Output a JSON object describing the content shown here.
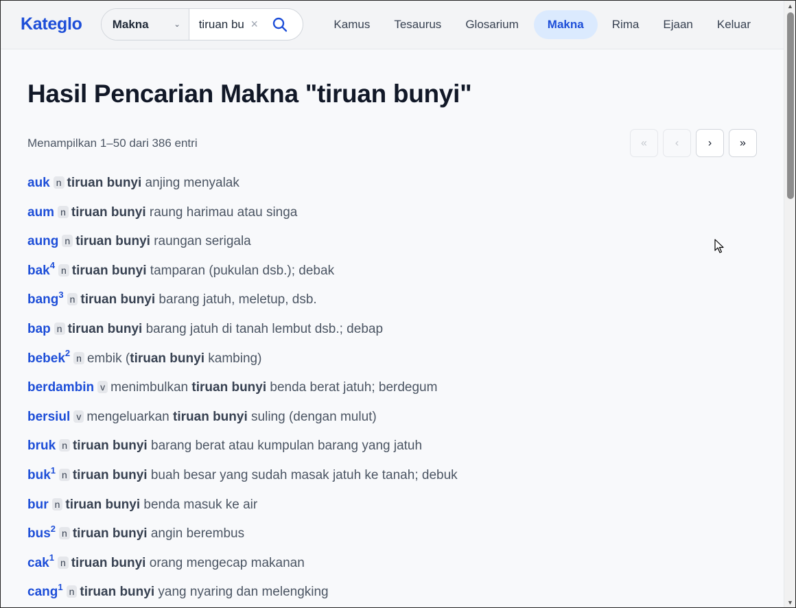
{
  "brand": "Kateglo",
  "search": {
    "mode": "Makna",
    "value": "tiruan bunyi",
    "clear_icon": "×"
  },
  "nav": [
    {
      "label": "Kamus",
      "active": false
    },
    {
      "label": "Tesaurus",
      "active": false
    },
    {
      "label": "Glosarium",
      "active": false
    },
    {
      "label": "Makna",
      "active": true
    },
    {
      "label": "Rima",
      "active": false
    },
    {
      "label": "Ejaan",
      "active": false
    },
    {
      "label": "Keluar",
      "active": false
    }
  ],
  "page_title": "Hasil Pencarian Makna \"tiruan bunyi\"",
  "result_count": "Menampilkan 1–50 dari 386 entri",
  "pager": {
    "first": "«",
    "prev": "‹",
    "next": "›",
    "last": "»"
  },
  "entries": [
    {
      "word": "auk",
      "sup": "",
      "pos": "n",
      "before": "",
      "hl": "tiruan bunyi",
      "after": " anjing menyalak"
    },
    {
      "word": "aum",
      "sup": "",
      "pos": "n",
      "before": "",
      "hl": "tiruan bunyi",
      "after": " raung harimau atau singa"
    },
    {
      "word": "aung",
      "sup": "",
      "pos": "n",
      "before": "",
      "hl": "tiruan bunyi",
      "after": " raungan serigala"
    },
    {
      "word": "bak",
      "sup": "4",
      "pos": "n",
      "before": "",
      "hl": "tiruan bunyi",
      "after": " tamparan (pukulan dsb.); debak"
    },
    {
      "word": "bang",
      "sup": "3",
      "pos": "n",
      "before": "",
      "hl": "tiruan bunyi",
      "after": " barang jatuh, meletup, dsb."
    },
    {
      "word": "bap",
      "sup": "",
      "pos": "n",
      "before": "",
      "hl": "tiruan bunyi",
      "after": " barang jatuh di tanah lembut dsb.; debap"
    },
    {
      "word": "bebek",
      "sup": "2",
      "pos": "n",
      "before": "embik (",
      "hl": "tiruan bunyi",
      "after": " kambing)"
    },
    {
      "word": "berdambin",
      "sup": "",
      "pos": "v",
      "before": "menimbulkan ",
      "hl": "tiruan bunyi",
      "after": " benda berat jatuh; berdegum"
    },
    {
      "word": "bersiul",
      "sup": "",
      "pos": "v",
      "before": "mengeluarkan ",
      "hl": "tiruan bunyi",
      "after": " suling (dengan mulut)"
    },
    {
      "word": "bruk",
      "sup": "",
      "pos": "n",
      "before": "",
      "hl": "tiruan bunyi",
      "after": " barang berat atau kumpulan barang yang jatuh"
    },
    {
      "word": "buk",
      "sup": "1",
      "pos": "n",
      "before": "",
      "hl": "tiruan bunyi",
      "after": " buah besar yang sudah masak jatuh ke tanah; debuk"
    },
    {
      "word": "bur",
      "sup": "",
      "pos": "n",
      "before": "",
      "hl": "tiruan bunyi",
      "after": " benda masuk ke air"
    },
    {
      "word": "bus",
      "sup": "2",
      "pos": "n",
      "before": "",
      "hl": "tiruan bunyi",
      "after": " angin berembus"
    },
    {
      "word": "cak",
      "sup": "1",
      "pos": "n",
      "before": "",
      "hl": "tiruan bunyi",
      "after": " orang mengecap makanan"
    },
    {
      "word": "cang",
      "sup": "1",
      "pos": "n",
      "before": "",
      "hl": "tiruan bunyi",
      "after": " yang nyaring dan melengking"
    }
  ]
}
